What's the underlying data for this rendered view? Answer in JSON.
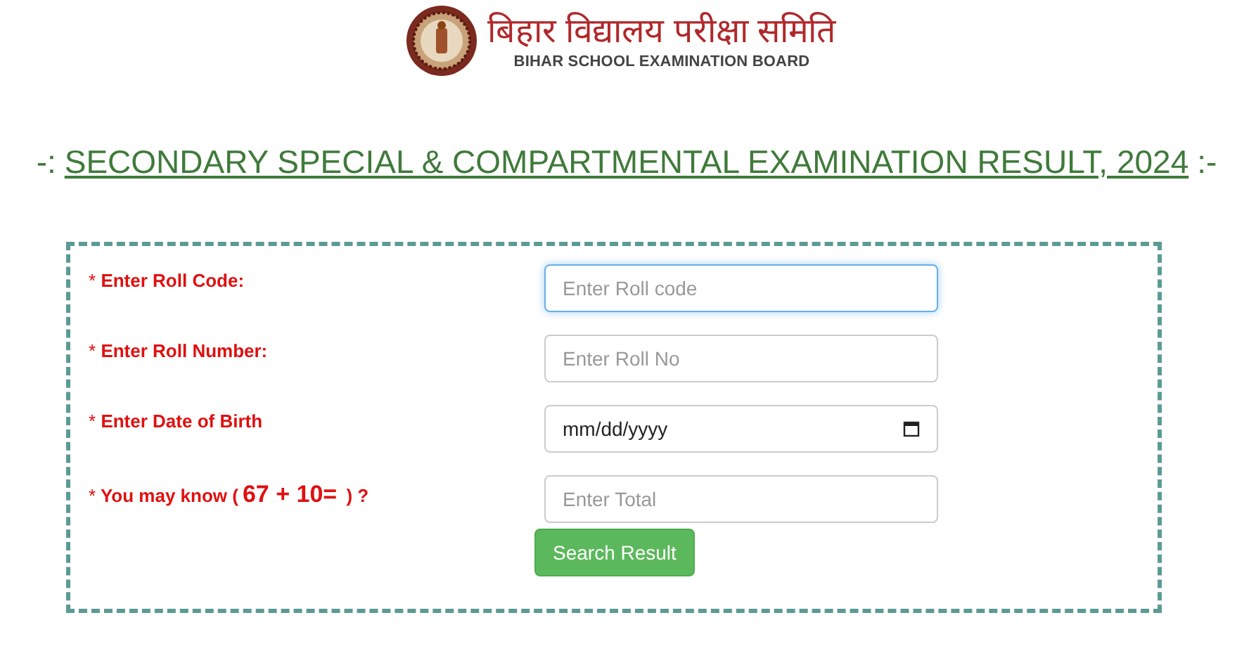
{
  "header": {
    "name_hindi": "बिहार विद्यालय परीक्षा समिति",
    "name_english": "BIHAR SCHOOL EXAMINATION BOARD"
  },
  "title": {
    "prefix": "-:",
    "text": "SECONDARY SPECIAL & COMPARTMENTAL EXAMINATION RESULT, 2024",
    "suffix": ":-"
  },
  "form": {
    "fields": [
      {
        "kind": "text",
        "marker": "*",
        "label": "Enter Roll Code:",
        "placeholder": "Enter Roll code",
        "focused": true
      },
      {
        "kind": "text",
        "marker": "*",
        "label": "Enter Roll Number:",
        "placeholder": "Enter Roll No",
        "focused": false
      },
      {
        "kind": "date",
        "marker": "*",
        "label": "Enter Date of Birth",
        "value": "mm/dd/yyyy",
        "focused": false
      },
      {
        "kind": "captcha",
        "marker": "*",
        "label": "You may know (",
        "equation": "67 + 10=",
        "suffix": ") ?",
        "placeholder": "Enter Total",
        "focused": false
      }
    ],
    "button": "Search Result"
  }
}
